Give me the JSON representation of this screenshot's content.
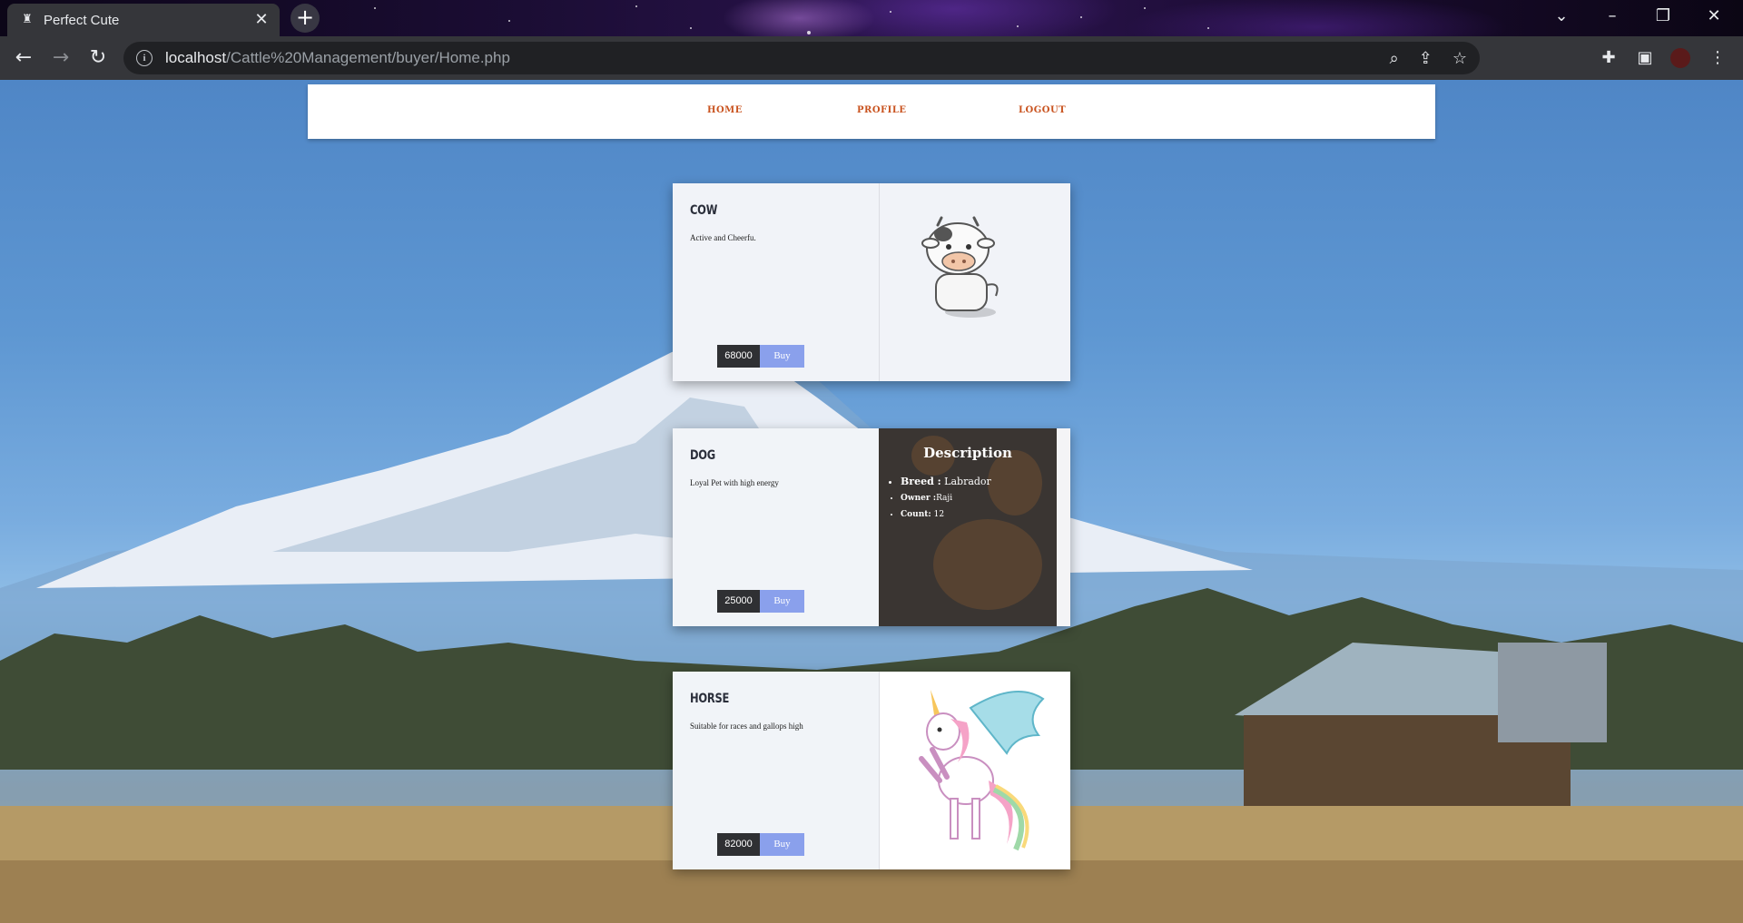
{
  "browser": {
    "tab_title": "Perfect Cute",
    "url_host": "localhost",
    "url_path": "/Cattle%20Management/buyer/Home.php"
  },
  "nav": {
    "home": "HOME",
    "profile": "PROFILE",
    "logout": "LOGOUT"
  },
  "cards": [
    {
      "name": "COW",
      "description": "Active and Cheerfu.",
      "price": "68000",
      "buy": "Buy"
    },
    {
      "name": "DOG",
      "description": "Loyal Pet with high energy",
      "price": "25000",
      "buy": "Buy",
      "overlay": {
        "heading": "Description",
        "breed_label": "Breed :",
        "breed": "Labrador",
        "owner_label": "Owner :",
        "owner": "Raji",
        "count_label": "Count:",
        "count": "12"
      }
    },
    {
      "name": "HORSE",
      "description": "Suitable for races and gallops high",
      "price": "82000",
      "buy": "Buy"
    }
  ],
  "colors": {
    "nav_link": "#c9531f",
    "buy_button": "#8aa0ec",
    "price_tag": "#2f3033"
  }
}
